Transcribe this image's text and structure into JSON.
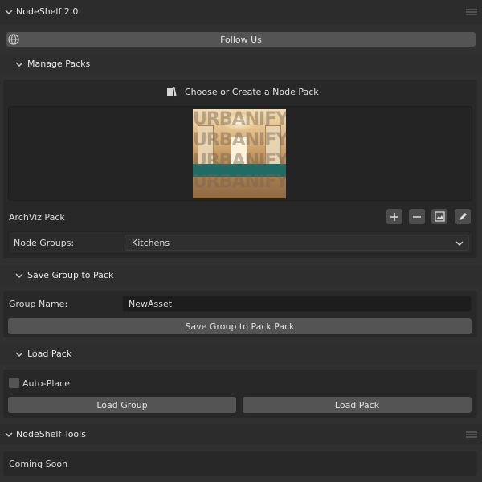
{
  "addon": {
    "title": "NodeShelf 2.0"
  },
  "follow": {
    "label": "Follow Us",
    "icon": "globe-icon"
  },
  "manage_packs": {
    "title": "Manage Packs",
    "choose_label": "Choose or Create a Node Pack",
    "preview_watermark": "URBANIFY",
    "pack_name": "ArchViz Pack",
    "node_groups_label": "Node Groups:",
    "node_groups_value": "Kitchens",
    "icons": [
      "plus-icon",
      "minus-icon",
      "image-icon",
      "pencil-icon"
    ]
  },
  "save_group": {
    "title": "Save Group to Pack",
    "group_name_label": "Group Name:",
    "group_name_value": "NewAsset",
    "save_button": "Save Group to Pack Pack"
  },
  "load_pack": {
    "title": "Load Pack",
    "auto_place_label": "Auto-Place",
    "auto_place_checked": false,
    "load_group_button": "Load Group",
    "load_pack_button": "Load Pack"
  },
  "tools": {
    "title": "NodeShelf Tools",
    "message": "Coming Soon"
  },
  "colors": {
    "background": "#303030",
    "panel": "#282828",
    "button": "#545454",
    "field": "#1d1d1d"
  }
}
